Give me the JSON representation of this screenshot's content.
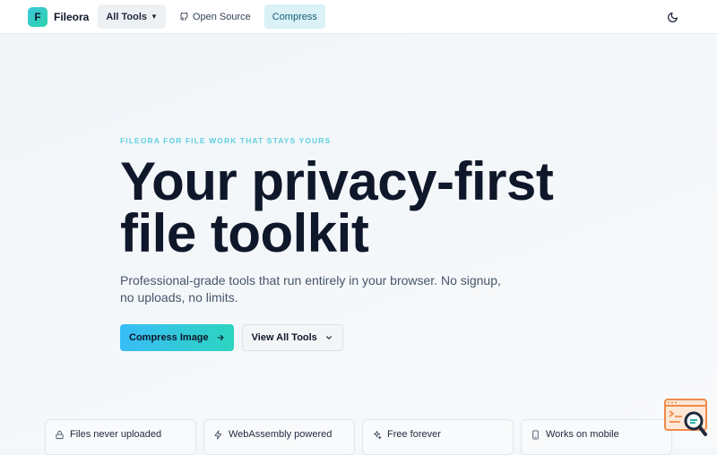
{
  "header": {
    "brand_letter": "F",
    "brand_name": "Fileora",
    "nav": {
      "all_tools": "All Tools",
      "open_source": "Open Source",
      "compress": "Compress"
    }
  },
  "hero": {
    "eyebrow": "FILEORA FOR FILE WORK THAT STAYS YOURS",
    "title_line1": "Your privacy-first",
    "title_line2": "file toolkit",
    "subtitle": "Professional-grade tools that run entirely in your browser. No signup, no uploads, no limits.",
    "primary_cta": "Compress Image",
    "secondary_cta": "View All Tools"
  },
  "features": [
    {
      "label": "Files never uploaded",
      "icon": "lock-icon"
    },
    {
      "label": "WebAssembly powered",
      "icon": "lightning-icon"
    },
    {
      "label": "Free forever",
      "icon": "sparkle-icon"
    },
    {
      "label": "Works on mobile",
      "icon": "phone-icon"
    }
  ],
  "colors": {
    "accent": "#2dd4bf",
    "brand_gradient_start": "#38bdf8",
    "eyebrow": "#5fd0de",
    "compress_tab_bg": "#d9f1f7",
    "floating_widget": "#f08a4b"
  }
}
